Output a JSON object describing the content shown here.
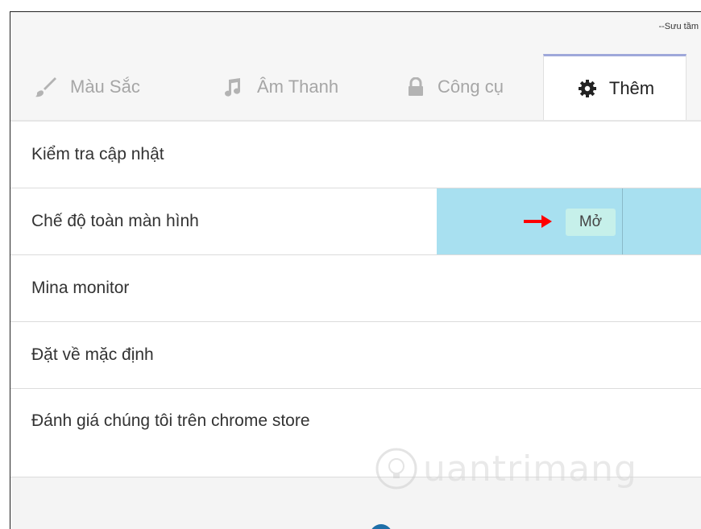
{
  "credit": "--Sưu tầm",
  "tabs": [
    {
      "label": "Màu Sắc",
      "icon": "brush-icon",
      "active": false
    },
    {
      "label": "Âm Thanh",
      "icon": "music-note-icon",
      "active": false
    },
    {
      "label": "Công cụ",
      "icon": "lock-icon",
      "active": false
    },
    {
      "label": "Thêm",
      "icon": "gear-icon",
      "active": true
    }
  ],
  "settings": {
    "items": [
      {
        "label": "Kiểm tra cập nhật"
      },
      {
        "label": "Chế độ toàn màn hình",
        "button": "Mở",
        "highlighted": true
      },
      {
        "label": "Mina monitor"
      },
      {
        "label": "Đặt về mặc định"
      },
      {
        "label": "Đánh giá chúng tôi trên chrome store"
      }
    ]
  },
  "watermark": "uantrimang",
  "colors": {
    "highlight": "#a8e0f0",
    "button": "#c6f0ea",
    "arrow": "#ff0000",
    "active_tab_border": "#9fa8da"
  }
}
